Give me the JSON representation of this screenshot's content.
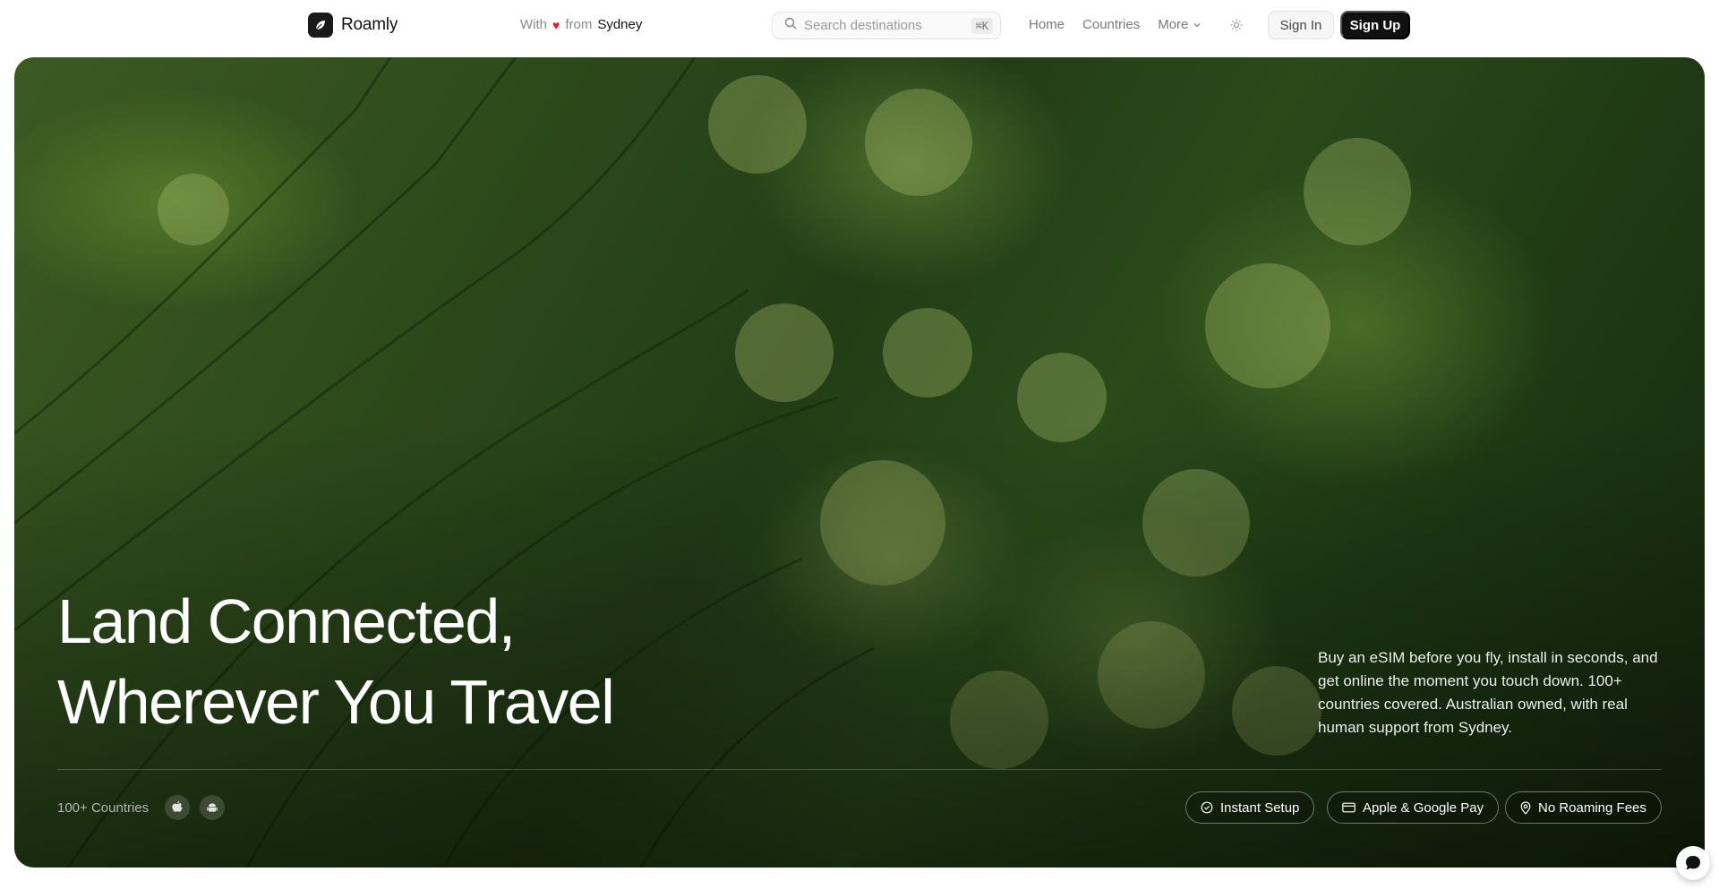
{
  "brand": {
    "name": "Roamly"
  },
  "tagline": {
    "prefix": "With",
    "heart": "♥",
    "middle": "from",
    "city": "Sydney"
  },
  "search": {
    "placeholder": "Search destinations",
    "shortcut": "⌘K"
  },
  "nav": {
    "items": [
      {
        "label": "Home"
      },
      {
        "label": "Countries"
      },
      {
        "label": "More"
      }
    ]
  },
  "auth": {
    "sign_in": "Sign In",
    "sign_up": "Sign Up"
  },
  "hero": {
    "headline_line1": "Land Connected,",
    "headline_line2": "Wherever You Travel",
    "blurb": "Buy an eSIM before you fly, install in seconds, and get online the moment you touch down. 100+ countries covered. Australian owned, with real human support from Sydney.",
    "countries_label": "100+ Countries",
    "platforms": [
      {
        "icon": "apple-icon"
      },
      {
        "icon": "android-icon"
      }
    ],
    "features": [
      {
        "label": "Instant Setup",
        "icon": "check-circle-icon"
      },
      {
        "label": "Apple & Google Pay",
        "icon": "credit-card-icon"
      },
      {
        "label": "No Roaming Fees",
        "icon": "map-pin-icon"
      }
    ]
  },
  "colors": {
    "brand_dark": "#111111",
    "heart": "#e11d2a",
    "hero_green": "#2d4a1b"
  }
}
